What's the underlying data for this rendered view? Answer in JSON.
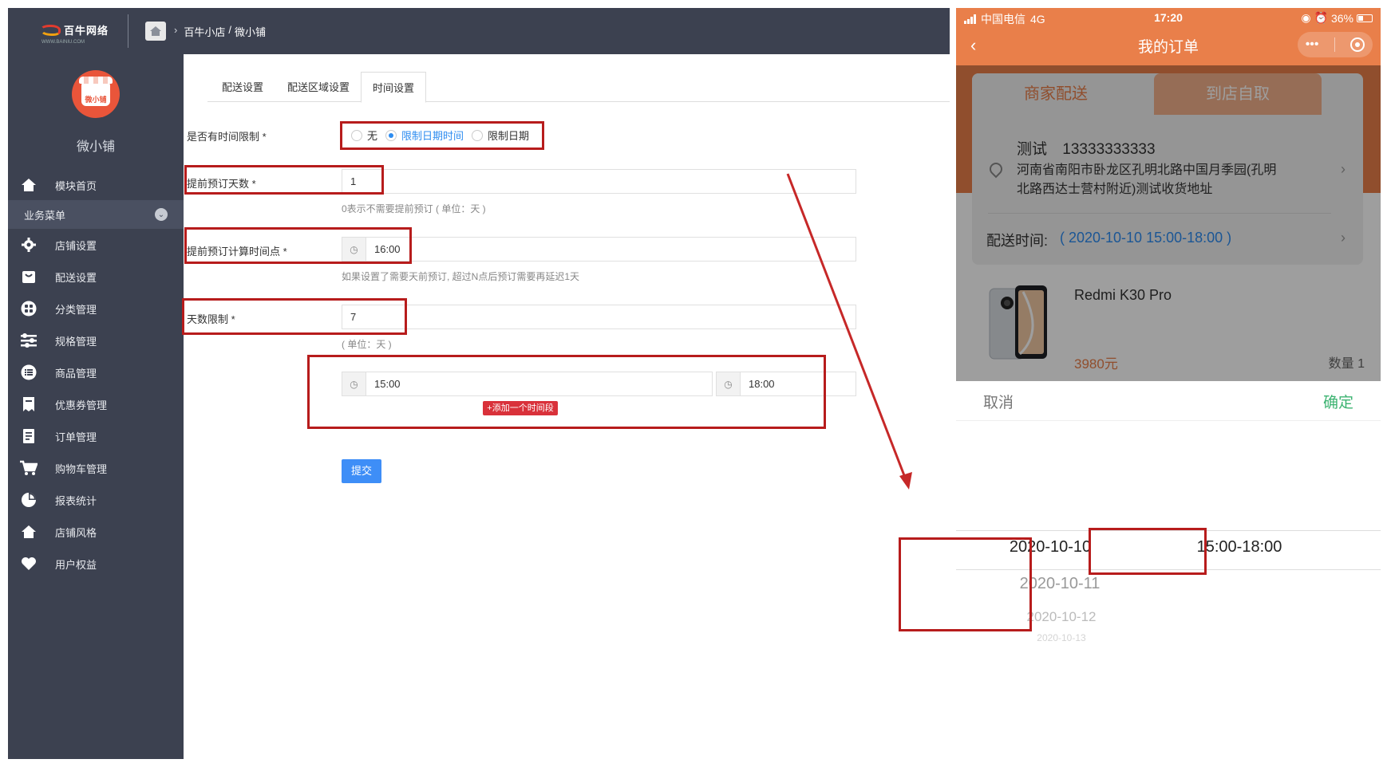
{
  "admin": {
    "logo_text": "百牛网络",
    "logo_sub": "WWW.BAINIU.COM",
    "breadcrumb": [
      "百牛小店",
      "/",
      "微小铺"
    ],
    "shop_name": "微小铺",
    "avatar_label": "微小铺",
    "nav": {
      "home": "模块首页",
      "group_label": "业务菜单",
      "items": [
        {
          "label": "店铺设置",
          "icon": "gear-icon"
        },
        {
          "label": "配送设置",
          "icon": "bag-icon"
        },
        {
          "label": "分类管理",
          "icon": "grid-icon"
        },
        {
          "label": "规格管理",
          "icon": "sliders-icon"
        },
        {
          "label": "商品管理",
          "icon": "list-icon"
        },
        {
          "label": "优惠券管理",
          "icon": "coupon-icon"
        },
        {
          "label": "订单管理",
          "icon": "receipt-icon"
        },
        {
          "label": "购物车管理",
          "icon": "cart-icon"
        },
        {
          "label": "报表统计",
          "icon": "pie-icon"
        },
        {
          "label": "店铺风格",
          "icon": "home-icon"
        },
        {
          "label": "用户权益",
          "icon": "heart-icon"
        }
      ]
    },
    "tabs": [
      "配送设置",
      "配送区域设置",
      "时间设置"
    ],
    "active_tab": "时间设置",
    "form": {
      "time_limit_label": "是否有时间限制 *",
      "radio_options": [
        "无",
        "限制日期时间",
        "限制日期"
      ],
      "radio_selected": "限制日期时间",
      "advance_days_label": "提前预订天数 *",
      "advance_days_value": "1",
      "advance_days_help": "0表示不需要提前预订 ( 单位：天 )",
      "advance_time_label": "提前预订计算时间点 *",
      "advance_time_value": "16:00",
      "advance_time_help": "如果设置了需要天前预订, 超过N点后预订需要再延迟1天",
      "day_limit_label": "天数限制 *",
      "day_limit_value": "7",
      "day_limit_help": "( 单位：天 )",
      "period_start": "15:00",
      "period_end": "18:00",
      "add_period_label": "+添加一个时间段",
      "submit_label": "提交"
    }
  },
  "phone": {
    "carrier": "中国电信",
    "network": "4G",
    "time": "17:20",
    "battery": "36%",
    "title": "我的订单",
    "tabs": [
      "商家配送",
      "到店自取"
    ],
    "contact_name": "测试",
    "contact_phone": "13333333333",
    "address": "河南省南阳市卧龙区孔明北路中国月季园(孔明北路西达士营村附近)测试收货地址",
    "delivery_time_label": "配送时间:",
    "delivery_time_value": "( 2020-10-10 15:00-18:00 )",
    "product_name": "Redmi K30 Pro",
    "price": "3980元",
    "quantity": "数量 1",
    "picker": {
      "cancel": "取消",
      "confirm": "确定",
      "dates": [
        "2020-10-10",
        "2020-10-11",
        "2020-10-12",
        "2020-10-13"
      ],
      "times": [
        "15:00-18:00"
      ]
    }
  },
  "colors": {
    "sidebar_bg": "#3c4150",
    "phone_accent": "#e97f4a",
    "highlight_box": "#b71c1c",
    "primary_blue": "#3e8ef7",
    "add_button": "#d9313a",
    "confirm_green": "#3cb371"
  }
}
